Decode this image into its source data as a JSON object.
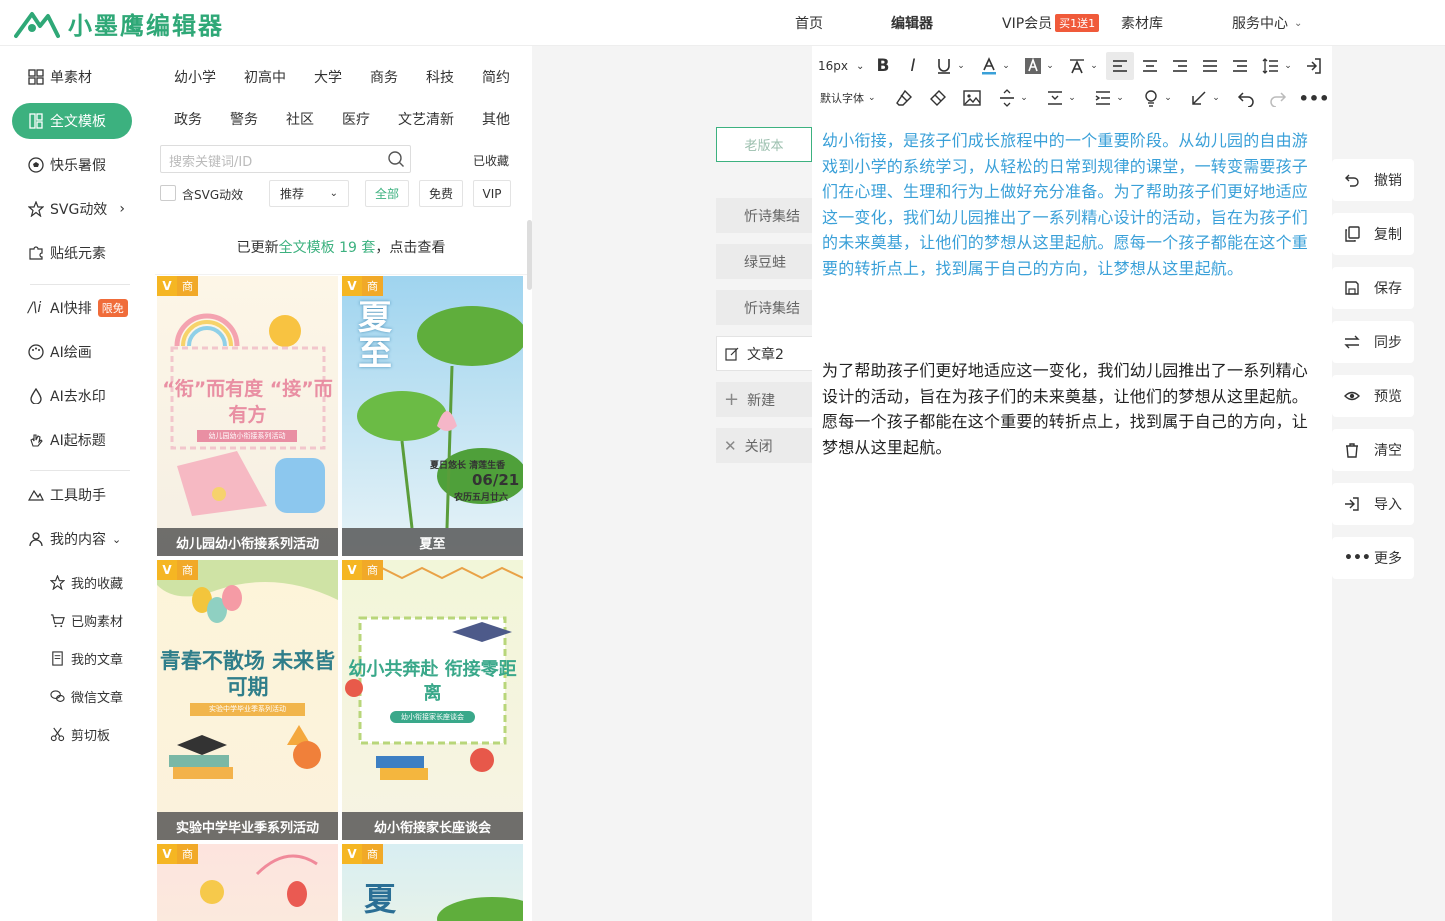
{
  "logo": {
    "text": "小墨鹰编辑器"
  },
  "nav": {
    "home": "首页",
    "editor": "编辑器",
    "vip": "VIP会员",
    "vip_badge": "买1送1",
    "library": "素材库",
    "service": "服务中心"
  },
  "sidebar": {
    "items": [
      "单素材",
      "全文模板",
      "快乐暑假",
      "SVG动效",
      "贴纸元素",
      "AI快排",
      "AI绘画",
      "AI去水印",
      "AI起标题",
      "工具助手",
      "我的内容"
    ],
    "ai_badge": "限免",
    "sub": [
      "我的收藏",
      "已购素材",
      "我的文章",
      "微信文章",
      "剪切板"
    ]
  },
  "categories": [
    "幼小学",
    "初高中",
    "大学",
    "商务",
    "科技",
    "简约",
    "政务",
    "警务",
    "社区",
    "医疗",
    "文艺清新",
    "其他"
  ],
  "search": {
    "placeholder": "搜索关键词/ID",
    "favorites": "已收藏"
  },
  "filters": {
    "svg": "含SVG动效",
    "sort": "推荐",
    "all": "全部",
    "free": "免费",
    "vip": "VIP"
  },
  "notice": {
    "prefix": "已更新",
    "link": "全文模板 19 套",
    "suffix": "，点击查看"
  },
  "cards": [
    {
      "title": "幼儿园幼小衔接系列活动",
      "tag": "商",
      "art": "“衔”而有度 “接”而有方",
      "sub": "幼儿园幼小衔接系列活动"
    },
    {
      "title": "夏至",
      "tag": "商",
      "art": "夏至",
      "sub": "夏日悠长 清莲生香",
      "date": "06/21",
      "lunar": "农历五月廿六"
    },
    {
      "title": "实验中学毕业季系列活动",
      "tag": "商",
      "art": "青春不散场 未来皆可期",
      "sub": "实验中学毕业季系列活动"
    },
    {
      "title": "幼小衔接家长座谈会",
      "tag": "商",
      "art": "幼小共奔赴 衔接零距离",
      "sub": "幼小衔接家长座谈会"
    },
    {
      "title": "",
      "tag": "商"
    },
    {
      "title": "",
      "tag": "商",
      "art": "夏"
    }
  ],
  "doc_tabs": {
    "old": "老版本",
    "t1": "忻诗集结",
    "t2": "绿豆蛙",
    "t3": "忻诗集结",
    "t4": "文章2",
    "new": "新建",
    "close": "关闭"
  },
  "toolbar": {
    "font_size": "16px",
    "font": "默认字体"
  },
  "content": {
    "p1": "幼小衔接，是孩子们成长旅程中的一个重要阶段。从幼儿园的自由游戏到小学的系统学习，从轻松的日常到规律的课堂，一转变需要孩子们在心理、生理和行为上做好充分准备。为了帮助孩子们更好地适应这一变化，我们幼儿园推出了一系列精心设计的活动，旨在为孩子们的未来奠基，让他们的梦想从这里起航。愿每一个孩子都能在这个重要的转折点上，找到属于自己的方向，让梦想从这里起航。",
    "p2": "为了帮助孩子们更好地适应这一变化，我们幼儿园推出了一系列精心设计的活动，旨在为孩子们的未来奠基，让他们的梦想从这里起航。愿每一个孩子都能在这个重要的转折点上，找到属于自己的方向，让梦想从这里起航。"
  },
  "actions": [
    "撤销",
    "复制",
    "保存",
    "同步",
    "预览",
    "清空",
    "导入",
    "更多"
  ],
  "colors": {
    "brand": "#3cb17f",
    "blue_text": "#3aa0d8"
  }
}
